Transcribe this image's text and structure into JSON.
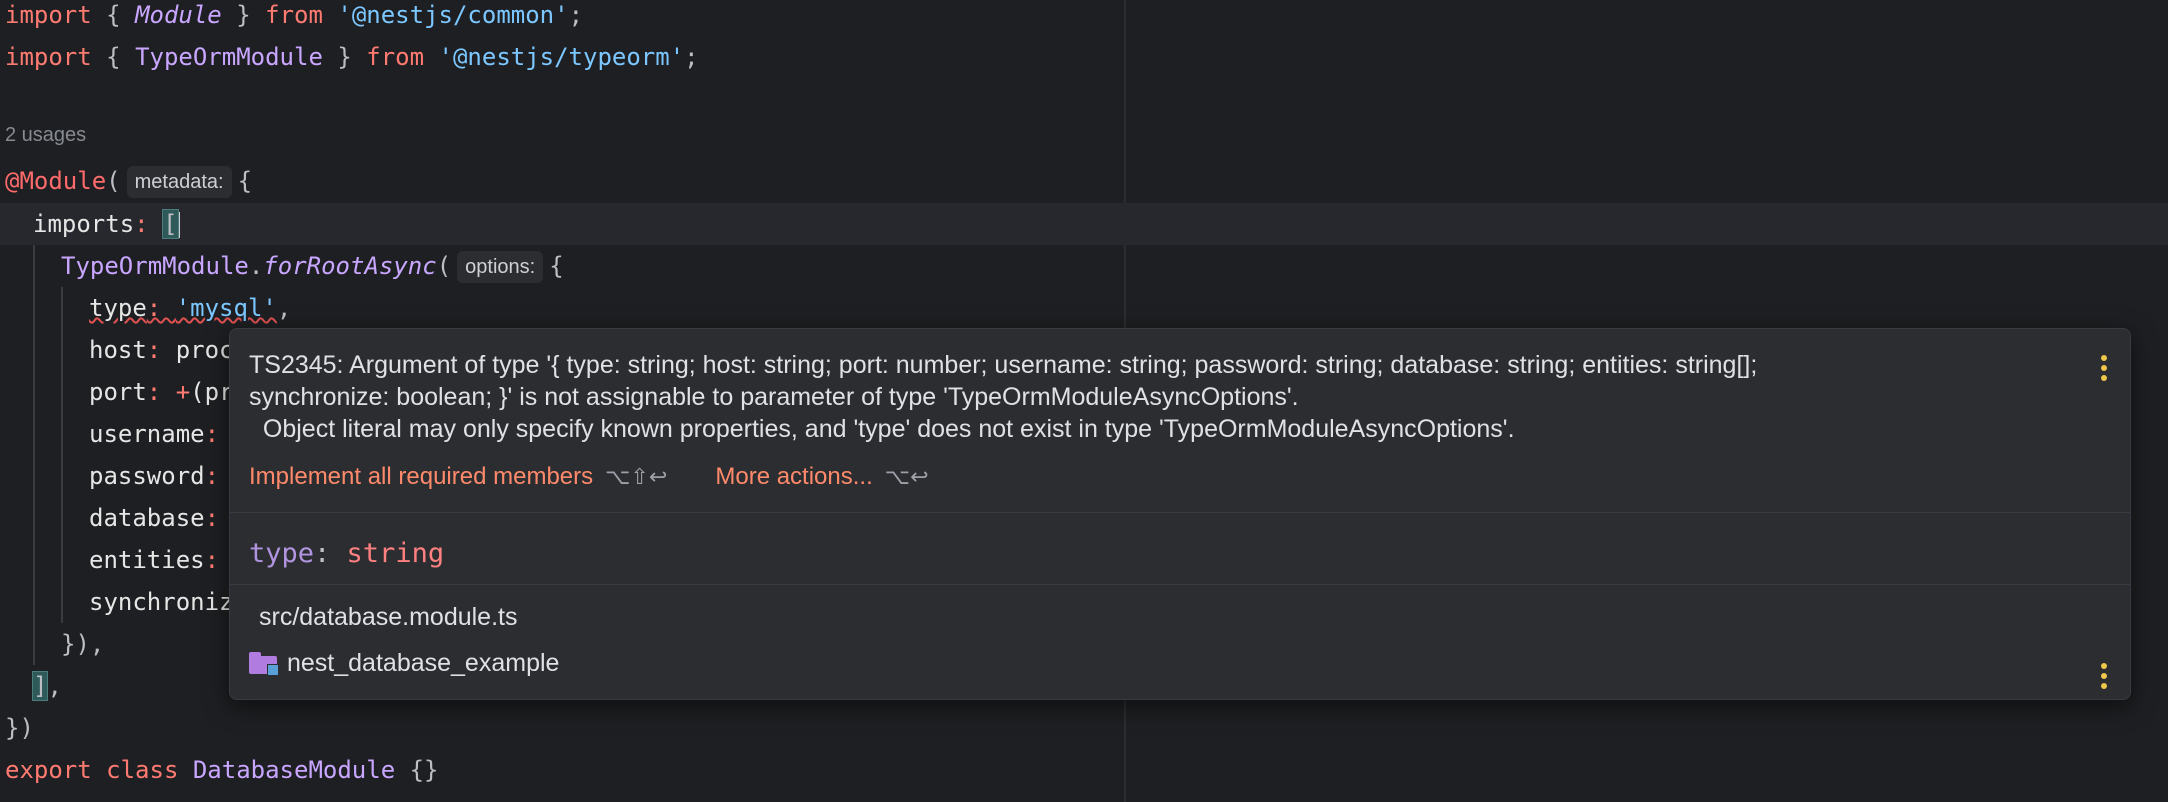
{
  "editor": {
    "lines": {
      "l1": {
        "kw_import": "import",
        "open": " { ",
        "name": "Module",
        "close": " } ",
        "kw_from": "from",
        "space": " ",
        "str": "'@nestjs/common'",
        "semi": ";"
      },
      "l2": {
        "kw_import": "import",
        "open": " { ",
        "name": "TypeOrmModule",
        "close": " } ",
        "kw_from": "from",
        "space": " ",
        "str": "'@nestjs/typeorm'",
        "semi": ";"
      },
      "usages": "2 usages",
      "l4": {
        "decorator": "@Module",
        "paren": "(",
        "hint": "metadata:",
        "brace": "{"
      },
      "l5": {
        "prop": "imports",
        "colon": ": ",
        "bracket": "["
      },
      "l6": {
        "cls": "TypeOrmModule",
        "dot": ".",
        "method": "forRootAsync",
        "paren": "(",
        "hint": "options:",
        "brace": "{"
      },
      "l7": {
        "prop": "type",
        "colon": ": ",
        "str": "'mysql'",
        "comma": ","
      },
      "l8": {
        "prop": "host",
        "colon": ": ",
        "rest": "proc"
      },
      "l9": {
        "prop": "port",
        "colon": ": ",
        "plus": "+",
        "rest": "(pr"
      },
      "l10": {
        "prop": "username",
        "colon": ":"
      },
      "l11": {
        "prop": "password",
        "colon": ":"
      },
      "l12": {
        "prop": "database",
        "colon": ":"
      },
      "l13": {
        "prop": "entities",
        "colon": ":"
      },
      "l14": {
        "prop": "synchroniz"
      },
      "l15": {
        "text": "}),"
      },
      "l16": {
        "bracket": "]",
        "comma": ","
      },
      "l17": {
        "text": "})"
      },
      "l18": {
        "kw_export": "export",
        "sp1": " ",
        "kw_class": "class",
        "sp2": " ",
        "name": "DatabaseModule",
        "rest": " {}"
      }
    }
  },
  "popup": {
    "error_line1": "TS2345: Argument of type '{ type: string; host: string; port: number; username: string; password: string; database: string; entities: string[];",
    "error_line2": "synchronize: boolean; }' is not assignable to parameter of type 'TypeOrmModuleAsyncOptions'.",
    "error_line3": "  Object literal may only specify known properties, and 'type' does not exist in type 'TypeOrmModuleAsyncOptions'.",
    "action1_label": "Implement all required members",
    "action1_shortcut": "⌥⇧↩",
    "action2_label": "More actions...",
    "action2_shortcut": "⌥↩",
    "type_prop": "type",
    "type_colon": ": ",
    "type_value": "string",
    "file_path": "src/database.module.ts",
    "project_name": "nest_database_example"
  },
  "colors": {
    "background": "#1e1f22",
    "popup_bg": "#2b2d30",
    "action_link": "#ff8a6b",
    "error_underline": "#e05252",
    "menu_dots": "#f0c64a"
  }
}
